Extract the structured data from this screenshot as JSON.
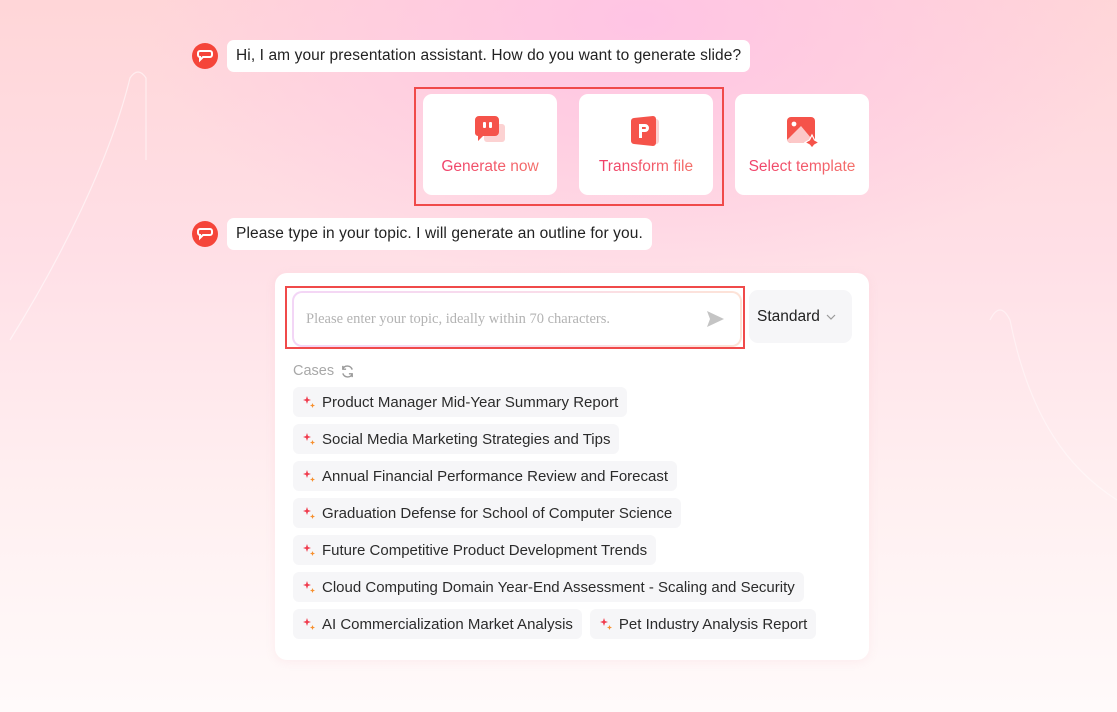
{
  "colors": {
    "accent": "#f5453a",
    "highlight_box": "#f04a4a",
    "label_gradient_start": "#f0406a",
    "label_gradient_end": "#f4706a"
  },
  "conversation": [
    {
      "role": "assistant",
      "avatar_icon": "chat-bubble-logo-icon",
      "text": "Hi, I am your presentation assistant. How do you want to generate slide?"
    },
    {
      "role": "assistant",
      "avatar_icon": "chat-bubble-logo-icon",
      "text": "Please type in your topic. I will generate an outline for you."
    }
  ],
  "generation_options": [
    {
      "label": "Generate now",
      "icon": "chat-bubbles-icon"
    },
    {
      "label": "Transform file",
      "icon": "powerpoint-file-icon"
    },
    {
      "label": "Select template",
      "icon": "image-sparkle-icon"
    }
  ],
  "topic_input": {
    "value": "",
    "placeholder": "Please enter your topic, ideally within 70 characters.",
    "send_icon": "send-arrow-icon"
  },
  "mode_select": {
    "selected": "Standard",
    "icon": "chevron-down-icon"
  },
  "cases": {
    "label": "Cases",
    "refresh_icon": "refresh-icon",
    "items": [
      "Product Manager Mid-Year Summary Report",
      "Social Media Marketing Strategies and Tips",
      "Annual Financial Performance Review and Forecast",
      "Graduation Defense for School of Computer Science",
      "Future Competitive Product Development Trends",
      "Cloud Computing Domain Year-End Assessment - Scaling and Security",
      "AI Commercialization Market Analysis",
      "Pet Industry Analysis Report"
    ]
  }
}
